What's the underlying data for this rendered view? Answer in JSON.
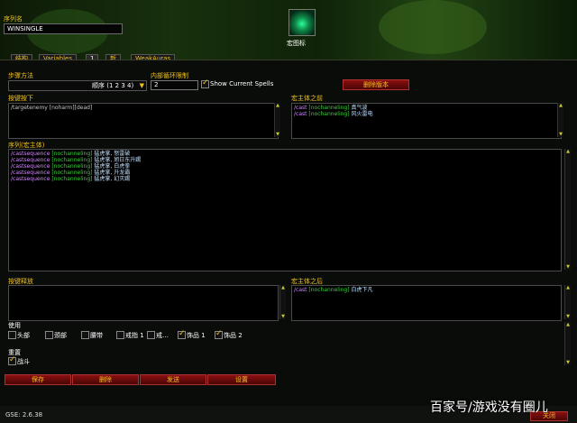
{
  "header": {
    "seq_name_label": "序列名",
    "seq_name_value": "WINSINGLE",
    "icon_caption": "宏图标"
  },
  "tabs": [
    {
      "label": "结构"
    },
    {
      "label": "Variables"
    },
    {
      "label": "1"
    },
    {
      "label": "新"
    },
    {
      "label": "WeakAuras"
    }
  ],
  "settings": {
    "step_method_label": "步骤方法",
    "step_method_value": "顺序 (1 2 3 4)",
    "inner_loop_label": "内部循环限制",
    "inner_loop_value": "2",
    "show_spells_label": "Show Current Spells",
    "show_spells_checked": true,
    "delete_version_label": "删除版本"
  },
  "keypress": {
    "label": "按键按下",
    "lines": [
      {
        "cmd": "/targetenemy",
        "cond": "[noharm][dead]",
        "spell": ""
      }
    ]
  },
  "premacro": {
    "label": "宏主体之前",
    "lines": [
      {
        "cmd": "/cast",
        "cond": "[nochanneling]",
        "spell": "真气波"
      },
      {
        "cmd": "/cast",
        "cond": "[nochanneling]",
        "spell": "风火雷电"
      }
    ]
  },
  "sequence": {
    "label": "序列(宏主体)",
    "lines": [
      {
        "cmd": "/castsequence",
        "cond": "[nochanneling]",
        "spell": "猛虎掌, 怒雷破"
      },
      {
        "cmd": "/castsequence",
        "cond": "[nochanneling]",
        "spell": "猛虎掌, 旭日东升踢"
      },
      {
        "cmd": "/castsequence",
        "cond": "[nochanneling]",
        "spell": "猛虎掌, 白虎拳"
      },
      {
        "cmd": "/castsequence",
        "cond": "[nochanneling]",
        "spell": "猛虎掌, 升龙霸"
      },
      {
        "cmd": "/castsequence",
        "cond": "[nochanneling]",
        "spell": "猛虎掌, 幻灭踢"
      }
    ]
  },
  "keyrelease": {
    "label": "按键释放",
    "lines": []
  },
  "postmacro": {
    "label": "宏主体之后",
    "lines": [
      {
        "cmd": "/cast",
        "cond": "[nochanneling]",
        "spell": "白虎下凡"
      }
    ]
  },
  "use_section": {
    "label": "使用",
    "items": [
      {
        "label": "头部",
        "checked": false
      },
      {
        "label": "颈部",
        "checked": false
      },
      {
        "label": "腰带",
        "checked": false
      },
      {
        "label": "戒指 1",
        "checked": false
      },
      {
        "label": "戒…",
        "checked": false
      },
      {
        "label": "饰品 1",
        "checked": true
      },
      {
        "label": "饰品 2",
        "checked": true
      }
    ]
  },
  "reset_section": {
    "label": "重置",
    "items": [
      {
        "label": "战斗",
        "checked": true
      }
    ]
  },
  "bottom_buttons": [
    {
      "label": "保存"
    },
    {
      "label": "删除"
    },
    {
      "label": "发送"
    },
    {
      "label": "设置"
    }
  ],
  "close_label": "关闭",
  "version": "GSE: 2.6.38",
  "watermark": "百家号/游戏没有圈儿",
  "colors": {
    "gold": "#f0c020",
    "command": "#d088ff",
    "condition": "#3ad13a",
    "button_red": "#8a1010"
  }
}
